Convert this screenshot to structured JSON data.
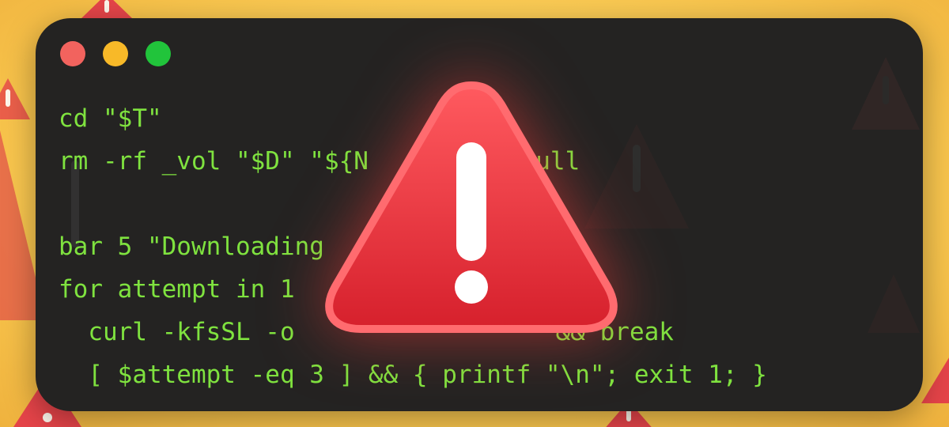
{
  "background": {
    "color_top": "#ffe27a",
    "color_edge": "#efb23e"
  },
  "terminal": {
    "background": "#242322",
    "text_color": "#7fe23f",
    "traffic_lights": {
      "close": "#f2635e",
      "minimize": "#f8b928",
      "zoom": "#21c43b"
    },
    "lines": [
      "cd \"$T\"",
      "rm -rf _vol \"$D\" \"${N",
      "",
      "bar 5 \"Downloading",
      "for attempt in 1",
      "  curl -kfsSL -o",
      "  [ $attempt -eq 3 ] && { printf \"\\n\"; exit 1; }"
    ],
    "line_fragments": {
      "line2_tail": "2>/dev/null",
      "line6_tail": "&& break"
    }
  },
  "overlay": {
    "icon": "warning-triangle-icon",
    "color": "#e8303a",
    "glyph": "!"
  }
}
